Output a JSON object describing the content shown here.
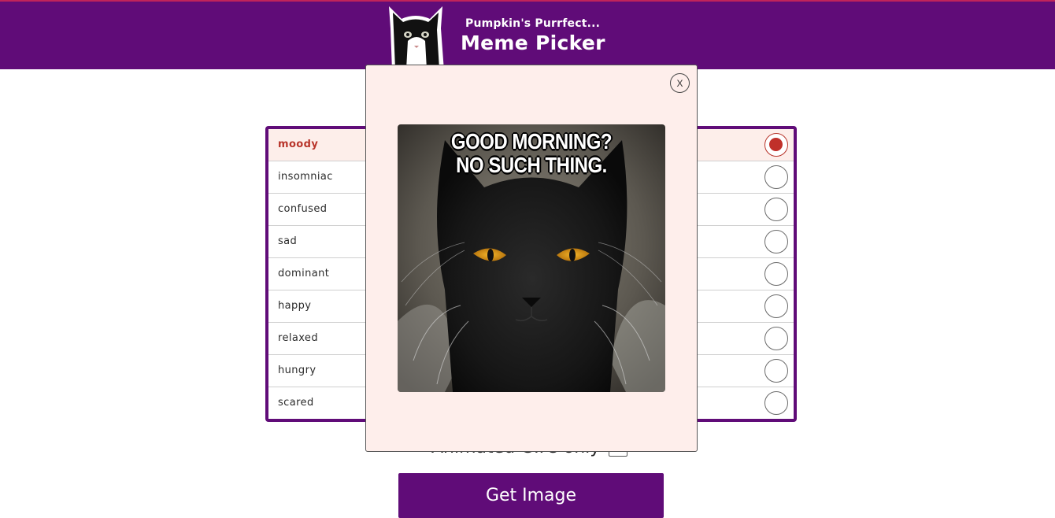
{
  "header": {
    "subtitle": "Pumpkin's Purrfect...",
    "title": "Meme Picker"
  },
  "emotions": [
    {
      "label": "moody",
      "selected": true
    },
    {
      "label": "insomniac",
      "selected": false
    },
    {
      "label": "confused",
      "selected": false
    },
    {
      "label": "sad",
      "selected": false
    },
    {
      "label": "dominant",
      "selected": false
    },
    {
      "label": "happy",
      "selected": false
    },
    {
      "label": "relaxed",
      "selected": false
    },
    {
      "label": "hungry",
      "selected": false
    },
    {
      "label": "scared",
      "selected": false
    }
  ],
  "options": {
    "gifs_label": "Animated GIFs only",
    "gifs_checked": false
  },
  "get_button": "Get Image",
  "modal": {
    "close_label": "X",
    "meme_line1": "GOOD MORNING?",
    "meme_line2": "NO SUCH THING."
  },
  "colors": {
    "brand": "#600c78",
    "selected_accent": "#c0302a",
    "modal_bg": "#feeeeb"
  }
}
